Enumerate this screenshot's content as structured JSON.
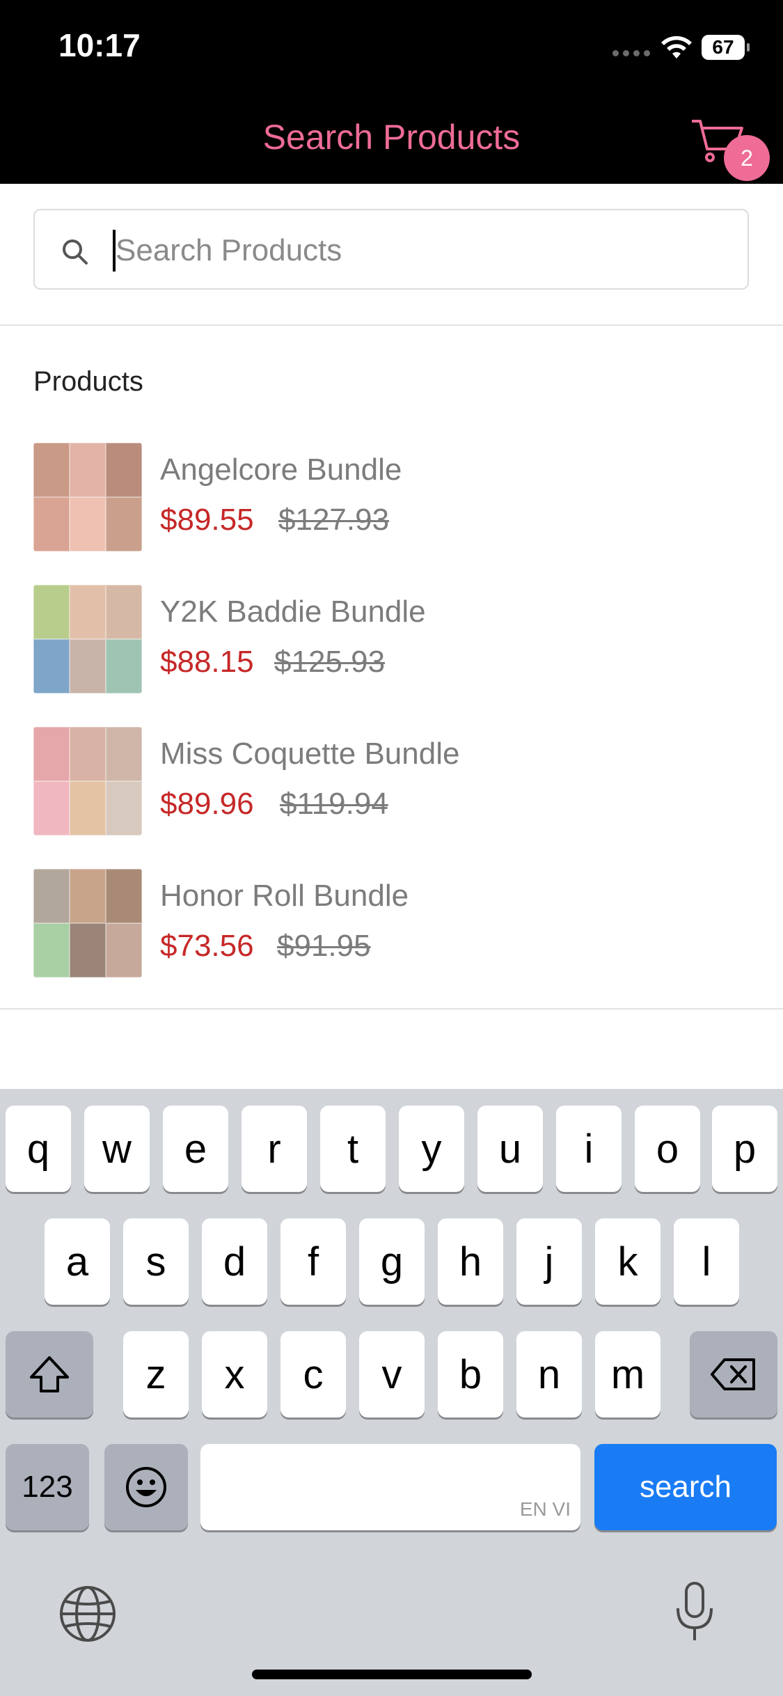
{
  "status_bar": {
    "time": "10:17",
    "battery": "67"
  },
  "header": {
    "title": "Search Products",
    "cart_count": "2"
  },
  "search": {
    "placeholder": "Search Products",
    "value": ""
  },
  "products": {
    "heading": "Products",
    "items": [
      {
        "name": "Angelcore Bundle",
        "sale_price": "$89.55",
        "original_price": "$127.93"
      },
      {
        "name": "Y2K Baddie Bundle",
        "sale_price": "$88.15",
        "original_price": "$125.93"
      },
      {
        "name": "Miss Coquette Bundle",
        "sale_price": "$89.96",
        "original_price": "$119.94"
      },
      {
        "name": "Honor Roll Bundle",
        "sale_price": "$73.56",
        "original_price": "$91.95"
      }
    ]
  },
  "keyboard": {
    "row1": [
      "q",
      "w",
      "e",
      "r",
      "t",
      "y",
      "u",
      "i",
      "o",
      "p"
    ],
    "row2": [
      "a",
      "s",
      "d",
      "f",
      "g",
      "h",
      "j",
      "k",
      "l"
    ],
    "row3": [
      "z",
      "x",
      "c",
      "v",
      "b",
      "n",
      "m"
    ],
    "numbers_key": "123",
    "space_hint": "EN VI",
    "action_key": "search"
  },
  "colors": {
    "accent_pink": "#ee6c95",
    "sale_red": "#c62828",
    "keyboard_blue": "#1a7cf5"
  }
}
